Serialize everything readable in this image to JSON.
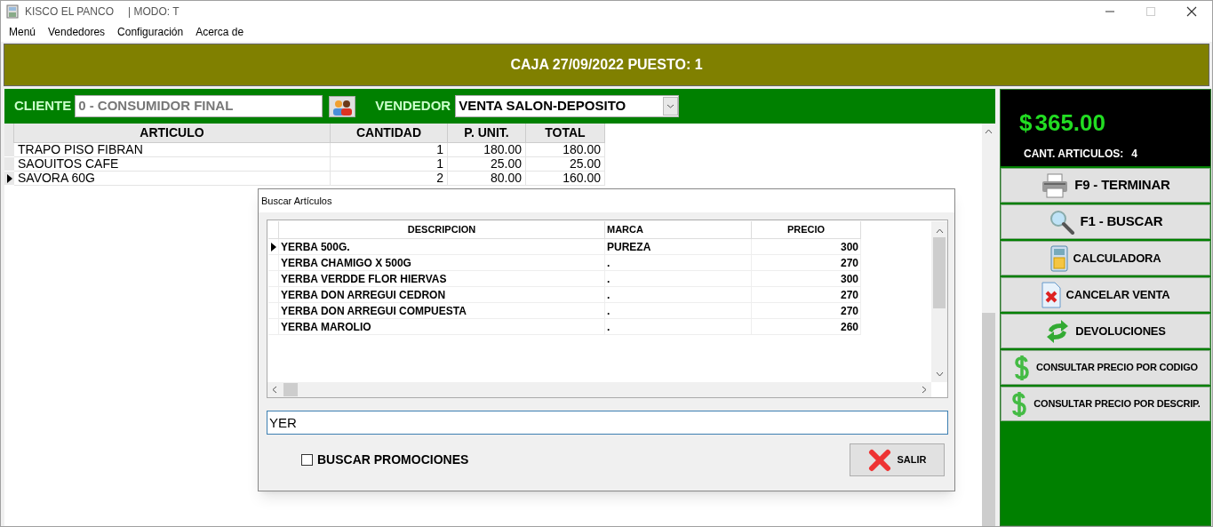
{
  "window": {
    "title": "KISCO EL PANCO",
    "mode": "| MODO: T"
  },
  "menu": [
    "Menú",
    "Vendedores",
    "Configuración",
    "Acerca de"
  ],
  "banner": "CAJA 27/09/2022  PUESTO: 1",
  "client": {
    "label": "CLIENTE",
    "value": "0 - CONSUMIDOR FINAL"
  },
  "seller": {
    "label": "VENDEDOR",
    "value": "VENTA SALON-DEPOSITO"
  },
  "sale_grid": {
    "columns": [
      "ARTICULO",
      "CANTIDAD",
      "P. UNIT.",
      "TOTAL"
    ],
    "rows": [
      {
        "cells": [
          "TRAPO PISO FIBRAN",
          "1",
          "180.00",
          "180.00"
        ],
        "selected": false
      },
      {
        "cells": [
          "SAOUITOS CAFE",
          "1",
          "25.00",
          "25.00"
        ],
        "selected": false
      },
      {
        "cells": [
          "SAVORA 60G",
          "2",
          "80.00",
          "160.00"
        ],
        "selected": true
      }
    ]
  },
  "total": {
    "symbol": "$",
    "amount": "365.00",
    "count_label": "CANT. ARTICULOS:",
    "count": "4"
  },
  "actions": [
    {
      "label": "F9 - TERMINAR",
      "kind": "printer"
    },
    {
      "label": "F1 - BUSCAR",
      "kind": "search"
    },
    {
      "label": "CALCULADORA",
      "kind": "calculator"
    },
    {
      "label": "CANCELAR VENTA",
      "kind": "cancel"
    },
    {
      "label": "DEVOLUCIONES",
      "kind": "refresh"
    },
    {
      "label": "CONSULTAR PRECIO POR CODIGO",
      "kind": "dollar"
    },
    {
      "label": "CONSULTAR PRECIO POR DESCRIP.",
      "kind": "dollar"
    }
  ],
  "search_dialog": {
    "title": "Buscar Artículos",
    "columns": [
      "DESCRIPCION",
      "MARCA",
      "PRECIO"
    ],
    "rows": [
      {
        "cells": [
          "YERBA 500G.",
          "PUREZA",
          "300"
        ],
        "selected": true
      },
      {
        "cells": [
          "YERBA CHAMIGO X 500G",
          ".",
          "270"
        ],
        "selected": false
      },
      {
        "cells": [
          "YERBA VERDDE FLOR HIERVAS",
          ".",
          "300"
        ],
        "selected": false
      },
      {
        "cells": [
          "YERBA DON ARREGUI CEDRON",
          ".",
          "270"
        ],
        "selected": false
      },
      {
        "cells": [
          "YERBA DON ARREGUI COMPUESTA",
          ".",
          "270"
        ],
        "selected": false
      },
      {
        "cells": [
          "YERBA MAROLIO",
          ".",
          "260"
        ],
        "selected": false
      }
    ],
    "query": "YER",
    "promo": {
      "label": "BUSCAR PROMOCIONES",
      "checked": false
    },
    "close_button": "SALIR"
  }
}
